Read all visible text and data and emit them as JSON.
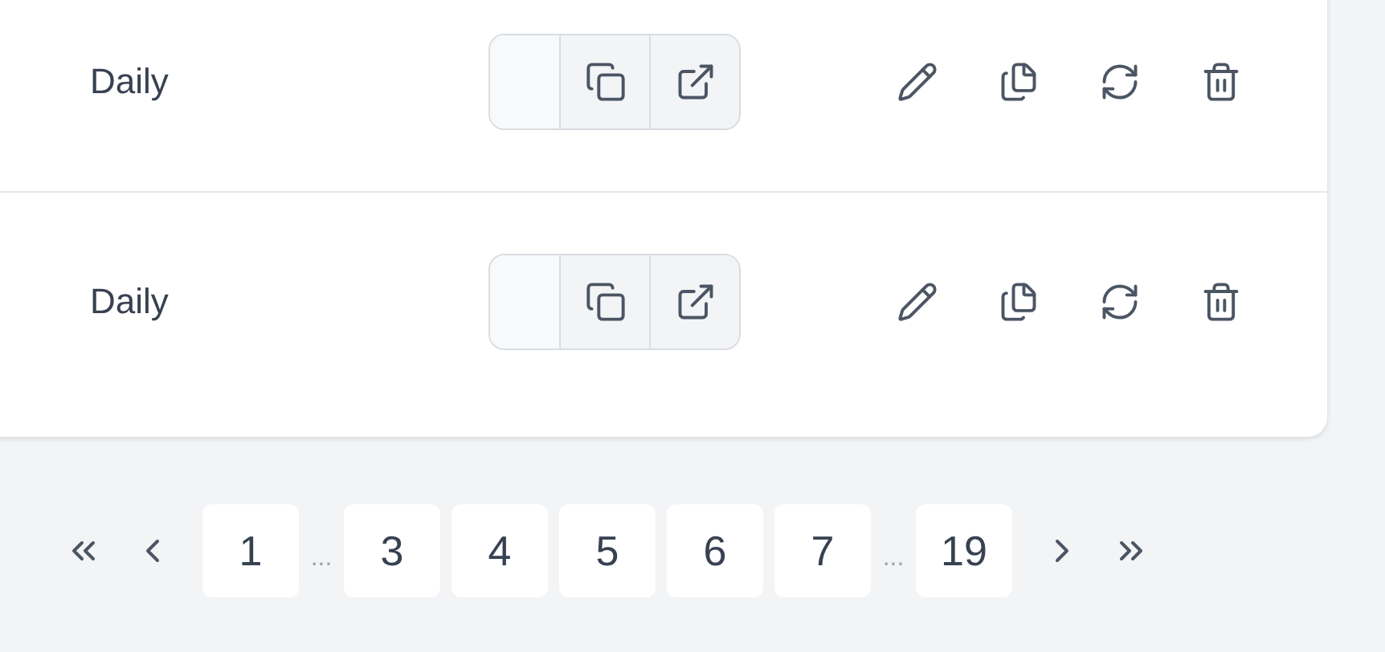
{
  "rows": [
    {
      "frequency": "Daily"
    },
    {
      "frequency": "Daily"
    }
  ],
  "pagination": [
    {
      "kind": "first"
    },
    {
      "kind": "prev"
    },
    {
      "kind": "page",
      "label": "1"
    },
    {
      "kind": "ellipsis",
      "label": "..."
    },
    {
      "kind": "page",
      "label": "3"
    },
    {
      "kind": "page",
      "label": "4"
    },
    {
      "kind": "page",
      "label": "5"
    },
    {
      "kind": "page",
      "label": "6"
    },
    {
      "kind": "page",
      "label": "7"
    },
    {
      "kind": "ellipsis",
      "label": "..."
    },
    {
      "kind": "page",
      "label": "19"
    },
    {
      "kind": "next"
    },
    {
      "kind": "last"
    }
  ]
}
